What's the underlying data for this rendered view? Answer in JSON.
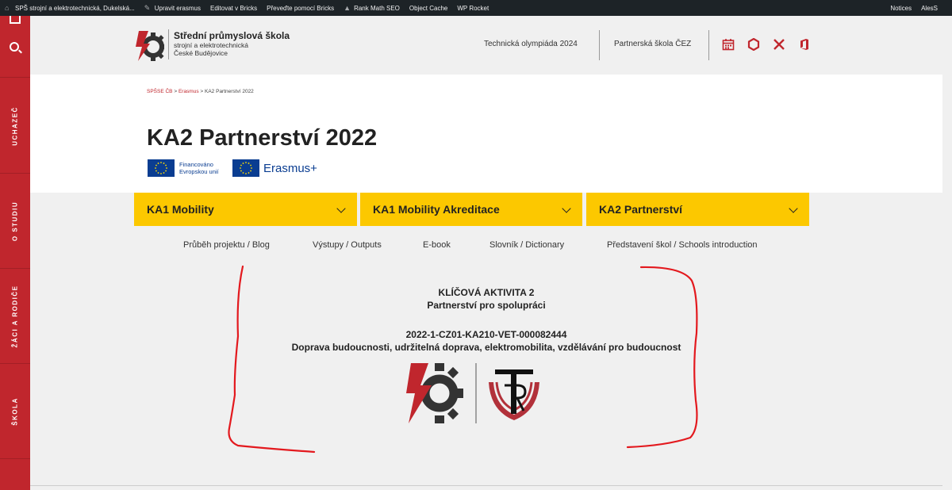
{
  "admin_bar": {
    "site": "SPŠ strojní a elektrotechnická, Dukelská...",
    "items": [
      "Upravit erasmus",
      "Editovat v Bricks",
      "Převeďte pomocí Bricks",
      "Rank Math SEO",
      "Object Cache",
      "WP Rocket"
    ],
    "notices": "Notices",
    "user": "AlesS"
  },
  "sidebar": {
    "items": [
      "UCHAZEČ",
      "O STUDIU",
      "ŽÁCI A RODIČE",
      "ŠKOLA"
    ]
  },
  "header": {
    "school_title": "Střední průmyslová škola",
    "school_sub1": "strojní a elektrotechnická",
    "school_sub2": "České Budějovice",
    "link1": "Technická olympiáda 2024",
    "link2": "Partnerská škola ČEZ"
  },
  "breadcrumb": {
    "home": "SPŠSE ČB",
    "sep1": " > ",
    "parent": "Erasmus",
    "sep2": " > ",
    "current": "KA2 Partnerství 2022"
  },
  "page_title": "KA2 Partnerství 2022",
  "badges": {
    "eu_line1": "Financováno",
    "eu_line2": "Evropskou unií",
    "erasmus": "Erasmus+"
  },
  "tabs": [
    "KA1 Mobility",
    "KA1 Mobility Akreditace",
    "KA2 Partnerství"
  ],
  "submenu": [
    "Průběh projektu / Blog",
    "Výstupy / Outputs",
    "E-book",
    "Slovník / Dictionary",
    "Představení škol / Schools introduction"
  ],
  "content": {
    "line1": "KLÍČOVÁ AKTIVITA 2",
    "line2": "Partnerství pro spolupráci",
    "line3": "2022-1-CZ01-KA210-VET-000082444",
    "line4": "Doprava budoucnosti, udržitelná doprava, elektromobilita, vzdělávání pro budoucnost"
  },
  "colors": {
    "brand_red": "#c0262d",
    "tab_yellow": "#fcc800",
    "admin_bar": "#1d2327",
    "eu_blue": "#0a3d91"
  },
  "icons": [
    "calendar-icon",
    "office365-icon",
    "tools-icon",
    "office-icon"
  ]
}
